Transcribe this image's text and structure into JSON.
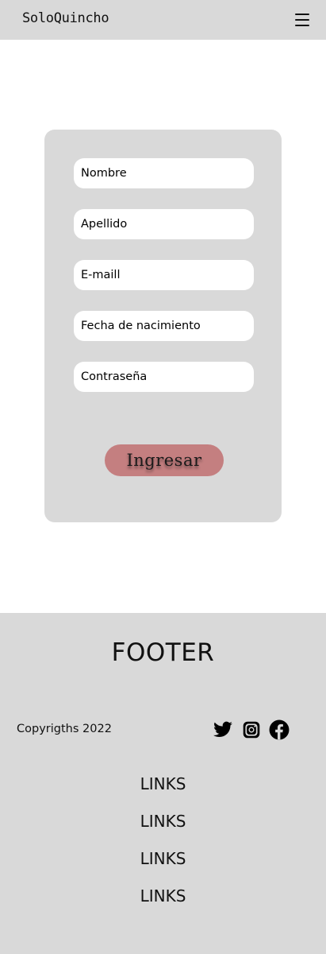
{
  "header": {
    "brand": "SoloQuincho",
    "menu_icon": "hamburger-menu-icon"
  },
  "form": {
    "fields": [
      {
        "placeholder": "Nombre"
      },
      {
        "placeholder": "Apellido"
      },
      {
        "placeholder": "E-maill"
      },
      {
        "placeholder": "Fecha de nacimiento"
      },
      {
        "placeholder": "Contraseña"
      }
    ],
    "submit_label": "Ingresar",
    "submit_color": "#c47f80"
  },
  "footer": {
    "title": "FOOTER",
    "copyright": "Copyrigths 2022",
    "social_icons": [
      "twitter-icon",
      "instagram-icon",
      "facebook-icon"
    ],
    "links": [
      "LINKS",
      "LINKS",
      "LINKS",
      "LINKS"
    ]
  },
  "colors": {
    "panel": "#d9d9d9",
    "background": "#ffffff"
  }
}
